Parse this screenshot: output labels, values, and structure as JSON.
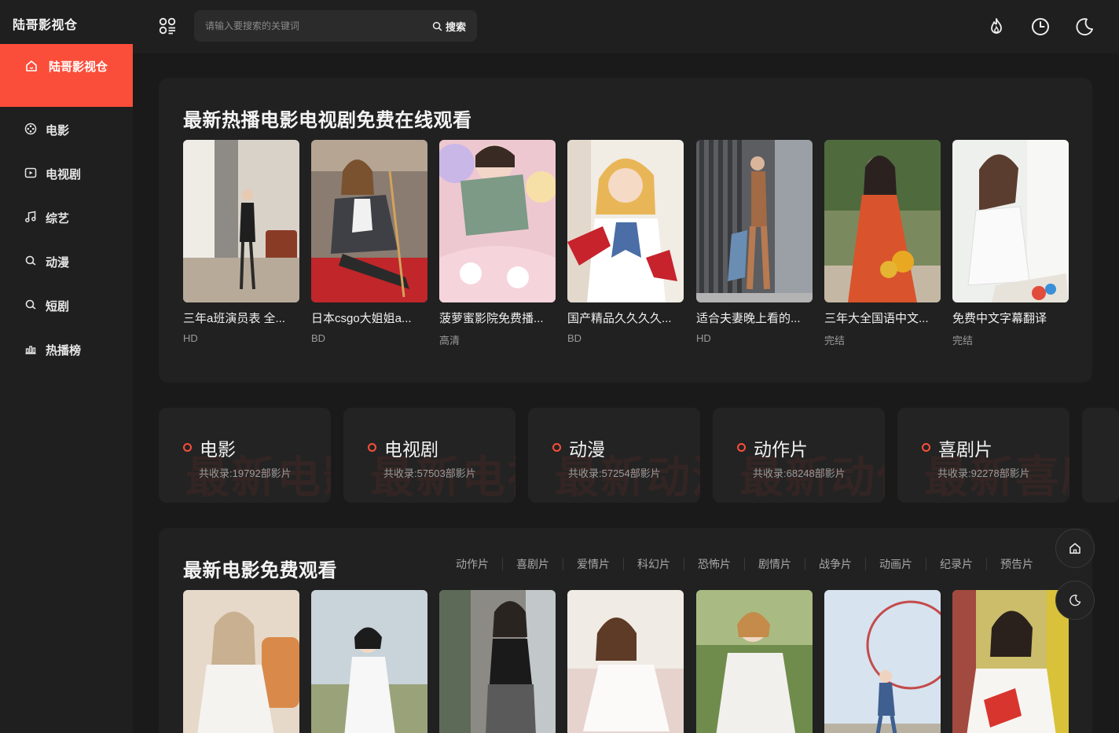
{
  "app": {
    "title": "陆哥影视仓"
  },
  "sidebar": {
    "active": {
      "label": "陆哥影视仓",
      "icon": "home-icon"
    },
    "items": [
      {
        "label": "电影",
        "icon": "film-reel-icon"
      },
      {
        "label": "电视剧",
        "icon": "tv-play-icon"
      },
      {
        "label": "综艺",
        "icon": "music-note-icon"
      },
      {
        "label": "动漫",
        "icon": "search-icon"
      },
      {
        "label": "短剧",
        "icon": "search-icon"
      },
      {
        "label": "热播榜",
        "icon": "bar-chart-icon"
      }
    ]
  },
  "header": {
    "search_placeholder": "请输入要搜索的关键词",
    "search_button": "搜索",
    "icons": [
      "apps-icon",
      "fire-icon",
      "clock-icon",
      "moon-icon"
    ]
  },
  "hot": {
    "title": "最新热播电影电视剧免费在线观看",
    "cards": [
      {
        "title": "三年a班演员表 全...",
        "badge": "HD"
      },
      {
        "title": "日本csgo大姐姐a...",
        "badge": "BD"
      },
      {
        "title": "菠萝蜜影院免费播...",
        "badge": "高清"
      },
      {
        "title": "国产精品久久久久...",
        "badge": "BD"
      },
      {
        "title": "适合夫妻晚上看的...",
        "badge": "HD"
      },
      {
        "title": "三年大全国语中文...",
        "badge": "完结"
      },
      {
        "title": "免费中文字幕翻译",
        "badge": "完结"
      }
    ]
  },
  "categories": [
    {
      "name": "电影",
      "count": "共收录:19792部影片",
      "watermark": "最新电影"
    },
    {
      "name": "电视剧",
      "count": "共收录:57503部影片",
      "watermark": "最新电视剧"
    },
    {
      "name": "动漫",
      "count": "共收录:57254部影片",
      "watermark": "最新动漫"
    },
    {
      "name": "动作片",
      "count": "共收录:68248部影片",
      "watermark": "最新动作片"
    },
    {
      "name": "喜剧片",
      "count": "共收录:92278部影片",
      "watermark": "最新喜剧片"
    }
  ],
  "movies": {
    "title": "最新电影免费观看",
    "tabs": [
      "动作片",
      "喜剧片",
      "爱情片",
      "科幻片",
      "恐怖片",
      "剧情片",
      "战争片",
      "动画片",
      "纪录片",
      "预告片"
    ]
  },
  "floating": [
    "home-icon",
    "moon-icon"
  ],
  "colors": {
    "accent": "#fb4e3a",
    "background": "#1a1a1a",
    "panel": "#212121"
  }
}
